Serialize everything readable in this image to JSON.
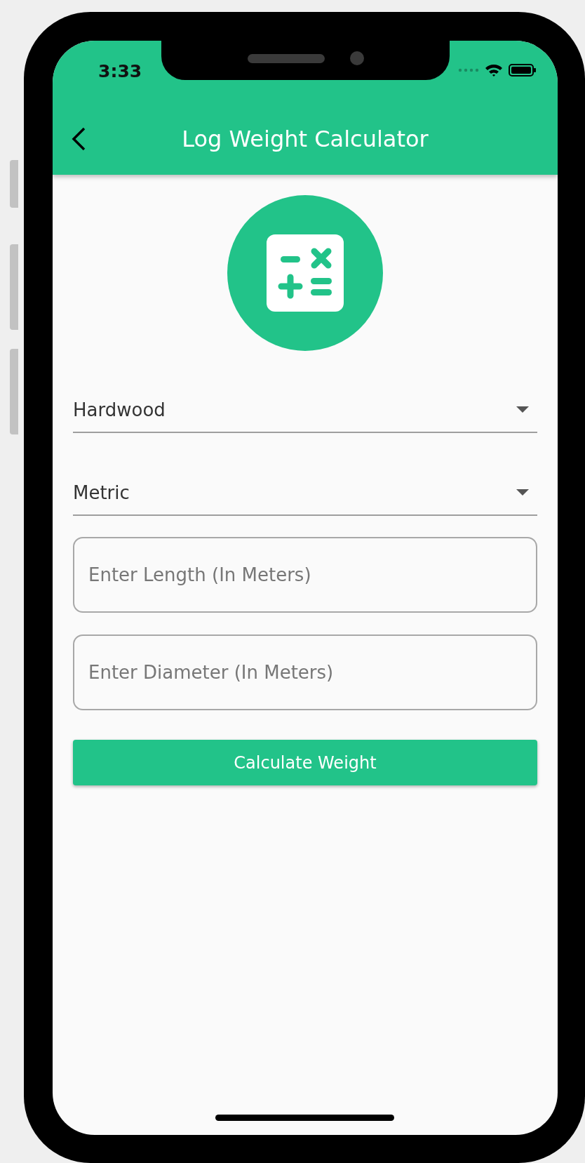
{
  "status_bar": {
    "time": "3:33"
  },
  "app_bar": {
    "title": "Log Weight Calculator"
  },
  "form": {
    "dropdowns": [
      {
        "value": "Hardwood"
      },
      {
        "value": "Metric"
      }
    ],
    "fields": [
      {
        "placeholder": "Enter Length (In Meters)"
      },
      {
        "placeholder": "Enter Diameter (In Meters)"
      }
    ],
    "button": "Calculate Weight"
  }
}
